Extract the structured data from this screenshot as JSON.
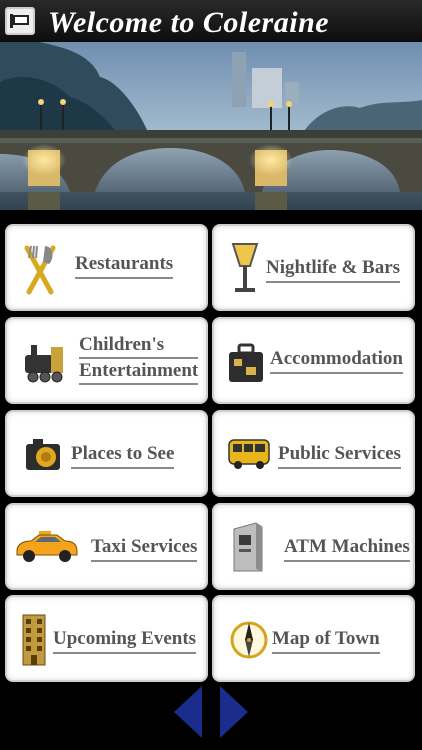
{
  "header": {
    "title": "Welcome to Coleraine",
    "back_icon": "back-flag-icon"
  },
  "hero": {
    "image": "coleraine-bridge-photo"
  },
  "menu": [
    {
      "id": "restaurants",
      "label": "Restaurants",
      "icon": "fork-knife-icon"
    },
    {
      "id": "nightlife",
      "label": "Nightlife & Bars",
      "icon": "cocktail-glass-icon"
    },
    {
      "id": "children",
      "label_line1": "Children's",
      "label_line2": "Entertainment",
      "icon": "toy-train-icon"
    },
    {
      "id": "accommodation",
      "label": "Accommodation",
      "icon": "suitcase-icon"
    },
    {
      "id": "places",
      "label": "Places to See",
      "icon": "camera-icon"
    },
    {
      "id": "public",
      "label": "Public Services",
      "icon": "bus-icon"
    },
    {
      "id": "taxi",
      "label": "Taxi Services",
      "icon": "taxi-icon"
    },
    {
      "id": "atm",
      "label": "ATM Machines",
      "icon": "atm-icon"
    },
    {
      "id": "events",
      "label": "Upcoming Events",
      "icon": "building-icon"
    },
    {
      "id": "map",
      "label": "Map of Town",
      "icon": "compass-icon"
    }
  ],
  "nav": {
    "prev_icon": "triangle-left-icon",
    "next_icon": "triangle-right-icon",
    "color": "#1b2d8c"
  }
}
